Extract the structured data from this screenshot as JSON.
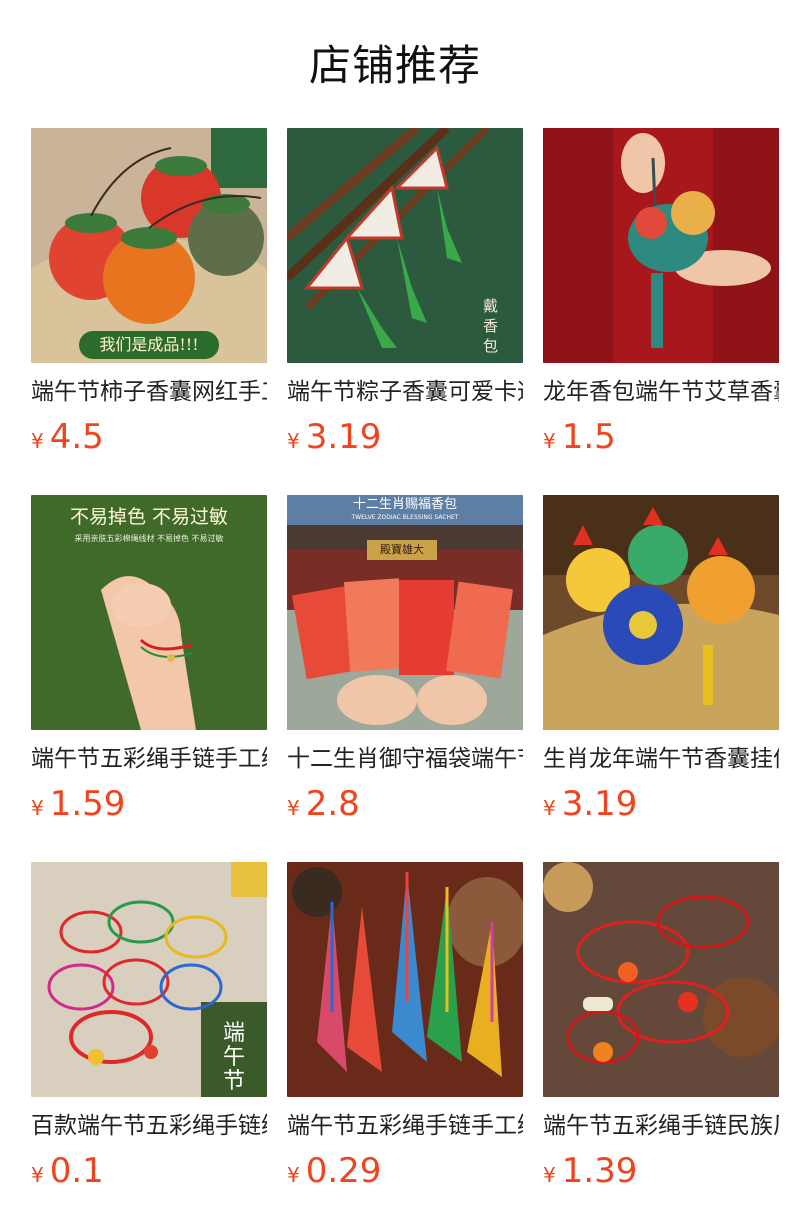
{
  "section": {
    "title": "店铺推荐"
  },
  "colors": {
    "price": "#f0441e",
    "title": "#111111"
  },
  "products": [
    {
      "name": "端午节柿子香囊网红手工",
      "currency": "¥",
      "price": "4.5",
      "image_text": "我们是成品!!!",
      "image": "persimmon-sachets-icon"
    },
    {
      "name": "端午节粽子香囊可爱卡通",
      "currency": "¥",
      "price": "3.19",
      "image_text": "戴香包",
      "image": "zongzi-sachets-icon"
    },
    {
      "name": "龙年香包端午节艾草香囊",
      "currency": "¥",
      "price": "1.5",
      "image_text": "",
      "image": "dragon-sachet-icon"
    },
    {
      "name": "端午节五彩绳手链手工编",
      "currency": "¥",
      "price": "1.59",
      "image_text": "不易掉色 不易过敏",
      "image_subtext": "采用亲肤五彩棉绳线材 不易掉色 不易过敏",
      "image": "bracelet-wrist-icon"
    },
    {
      "name": "十二生肖御守福袋端午节",
      "currency": "¥",
      "price": "2.8",
      "image_text": "十二生肖赐福香包",
      "image_subtext": "TWELVE ZODIAC BLESSING SACHET",
      "image_sign": "殿寶雄大",
      "image": "zodiac-pouches-icon"
    },
    {
      "name": "生肖龙年端午节香囊挂件",
      "currency": "¥",
      "price": "3.19",
      "image_text": "",
      "image": "dragon-plush-basket-icon"
    },
    {
      "name": "百款端午节五彩绳手链编",
      "currency": "¥",
      "price": "0.1",
      "image_text": "端午节",
      "image": "bracelet-pile-icon"
    },
    {
      "name": "端午节五彩绳手链手工编",
      "currency": "¥",
      "price": "0.29",
      "image_text": "",
      "image": "color-cords-icon"
    },
    {
      "name": "端午节五彩绳手链民族风",
      "currency": "¥",
      "price": "1.39",
      "image_text": "",
      "image": "red-bracelets-icon"
    }
  ]
}
